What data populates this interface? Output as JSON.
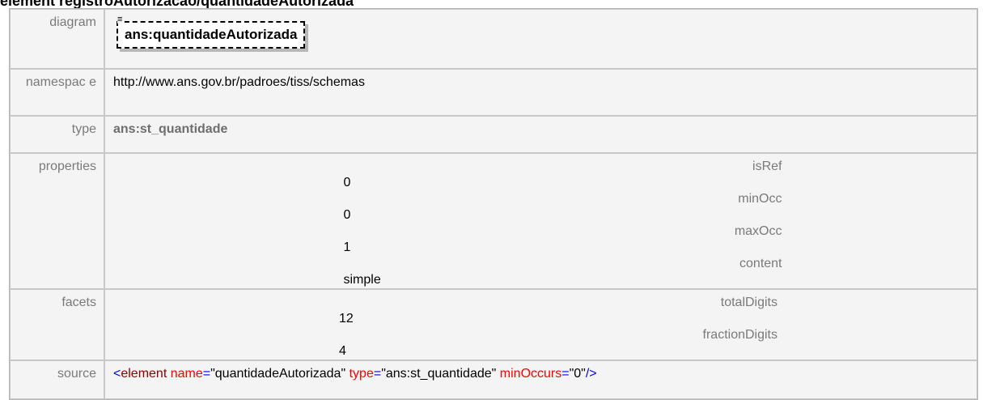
{
  "page_title": "element registroAutorizacao/quantidadeAutorizada",
  "rows": {
    "diagram": {
      "label": "diagram",
      "box_tag": "≡",
      "box_text": "ans:quantidadeAutorizada"
    },
    "namespace": {
      "label": "namespac e",
      "value": "http://www.ans.gov.br/padroes/tiss/schemas"
    },
    "type": {
      "label": "type",
      "value": "ans:st_quantidade"
    },
    "properties": {
      "label": "properties",
      "items": [
        {
          "key": "isRef",
          "value": "0"
        },
        {
          "key": "minOcc",
          "value": "0"
        },
        {
          "key": "maxOcc",
          "value": "1"
        },
        {
          "key": "content",
          "value": "simple"
        }
      ]
    },
    "facets": {
      "label": "facets",
      "items": [
        {
          "key": "totalDigits",
          "value": "12"
        },
        {
          "key": "fractionDigits",
          "value": "4"
        }
      ]
    },
    "source": {
      "label": "source",
      "open": "<",
      "tag": "element",
      "attr1_name": "name",
      "attr1_eq": "=",
      "attr1_value": "\"quantidadeAutorizada\"",
      "attr2_name": "type",
      "attr2_eq": "=",
      "attr2_value": "\"ans:st_quantidade\"",
      "attr3_name": "minOccurs",
      "attr3_eq": "=",
      "attr3_value": "\"0\"",
      "close": "/>"
    }
  },
  "colors": {
    "key_text": "#7a7a7a",
    "bracket": "#0000ff",
    "tag": "#8b0000",
    "attr_name": "#ff0000"
  }
}
